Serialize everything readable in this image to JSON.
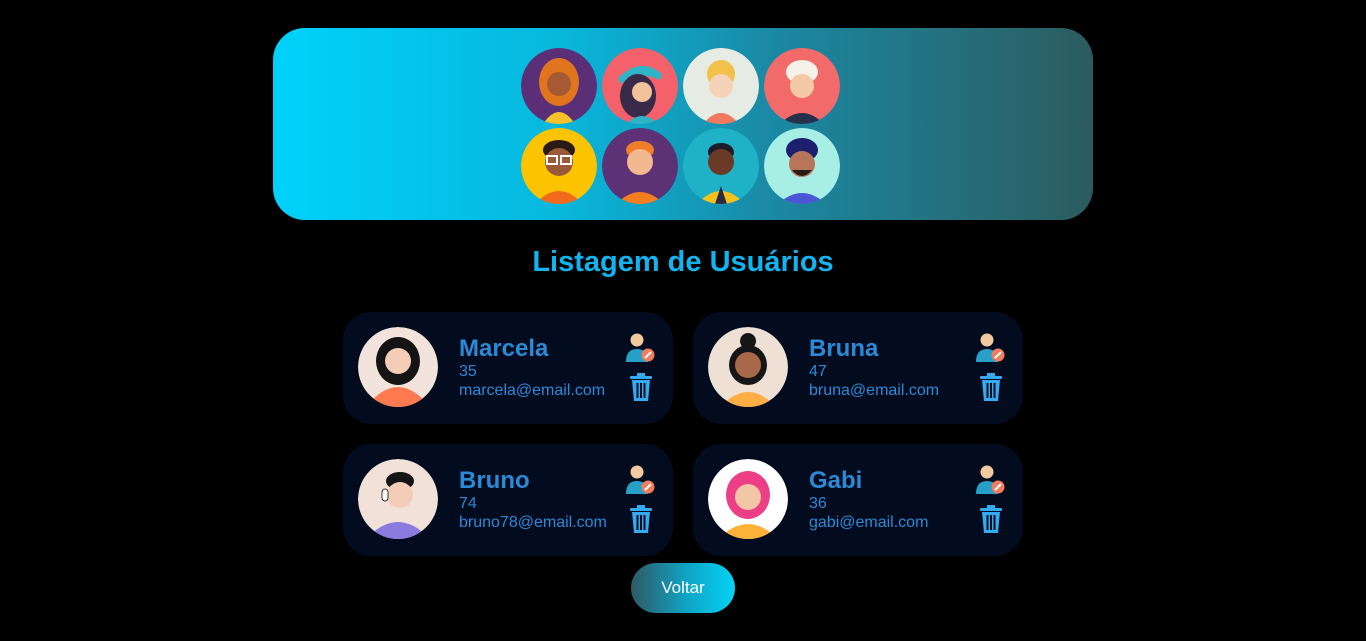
{
  "header": {
    "avatar_icons": [
      "woman-curly-hair-avatar",
      "woman-cap-avatar",
      "woman-blonde-ponytail-avatar",
      "man-white-hair-avatar",
      "man-glasses-avatar",
      "man-ginger-avatar",
      "man-hoodie-avatar",
      "man-curly-beard-avatar"
    ]
  },
  "page": {
    "title": "Listagem de Usuários"
  },
  "users": [
    {
      "name": "Marcela",
      "age": "35",
      "email": "marcela@email.com",
      "avatar": "woman-dark-hair-avatar"
    },
    {
      "name": "Bruna",
      "age": "47",
      "email": "bruna@email.com",
      "avatar": "woman-bun-avatar"
    },
    {
      "name": "Bruno",
      "age": "74",
      "email": "bruno78@email.com",
      "avatar": "man-headphones-avatar"
    },
    {
      "name": "Gabi",
      "age": "36",
      "email": "gabi@email.com",
      "avatar": "woman-pink-hair-avatar"
    }
  ],
  "actions": {
    "edit_icon": "edit-user-icon",
    "delete_icon": "trash-icon",
    "back_label": "Voltar"
  },
  "colors": {
    "accent": "#12b4ef",
    "text": "#2a8ad6",
    "card_bg": "#030b1f",
    "hero_start": "#00d2fb",
    "hero_end": "#2c5b5e"
  }
}
